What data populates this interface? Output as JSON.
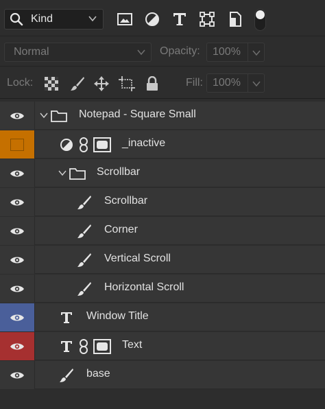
{
  "filter": {
    "kind_label": "Kind",
    "icons": [
      "image-filter-icon",
      "adjustment-filter-icon",
      "type-filter-icon",
      "shape-filter-icon",
      "smart-object-filter-icon"
    ]
  },
  "blend": {
    "mode": "Normal",
    "opacity_label": "Opacity:",
    "opacity_value": "100%"
  },
  "lock": {
    "label": "Lock:",
    "fill_label": "Fill:",
    "fill_value": "100%"
  },
  "colors": {
    "orange": "#c57000",
    "blue": "#4a5f9a",
    "red": "#a63030",
    "row": "#363636",
    "panel": "#2d2d2d"
  },
  "layers": [
    {
      "name": "Notepad - Square Small",
      "kind": "group",
      "indent": 0,
      "eye": "visible",
      "color": "none",
      "expanded": true
    },
    {
      "name": "_inactive",
      "kind": "adjustment",
      "indent": 1,
      "eye": "hidden",
      "color": "orange",
      "linked": true,
      "masked": true
    },
    {
      "name": "Scrollbar",
      "kind": "group",
      "indent": 1,
      "eye": "visible",
      "color": "none",
      "expanded": true
    },
    {
      "name": "Scrollbar",
      "kind": "pixel",
      "indent": 2,
      "eye": "visible",
      "color": "none"
    },
    {
      "name": "Corner",
      "kind": "pixel",
      "indent": 2,
      "eye": "visible",
      "color": "none"
    },
    {
      "name": "Vertical Scroll",
      "kind": "pixel",
      "indent": 2,
      "eye": "visible",
      "color": "none"
    },
    {
      "name": "Horizontal Scroll",
      "kind": "pixel",
      "indent": 2,
      "eye": "visible",
      "color": "none"
    },
    {
      "name": "Window Title",
      "kind": "type",
      "indent": 1,
      "eye": "visible",
      "color": "blue"
    },
    {
      "name": "Text",
      "kind": "type",
      "indent": 1,
      "eye": "visible",
      "color": "red",
      "linked": true,
      "masked": true
    },
    {
      "name": "base",
      "kind": "pixel",
      "indent": 1,
      "eye": "visible",
      "color": "none"
    }
  ]
}
